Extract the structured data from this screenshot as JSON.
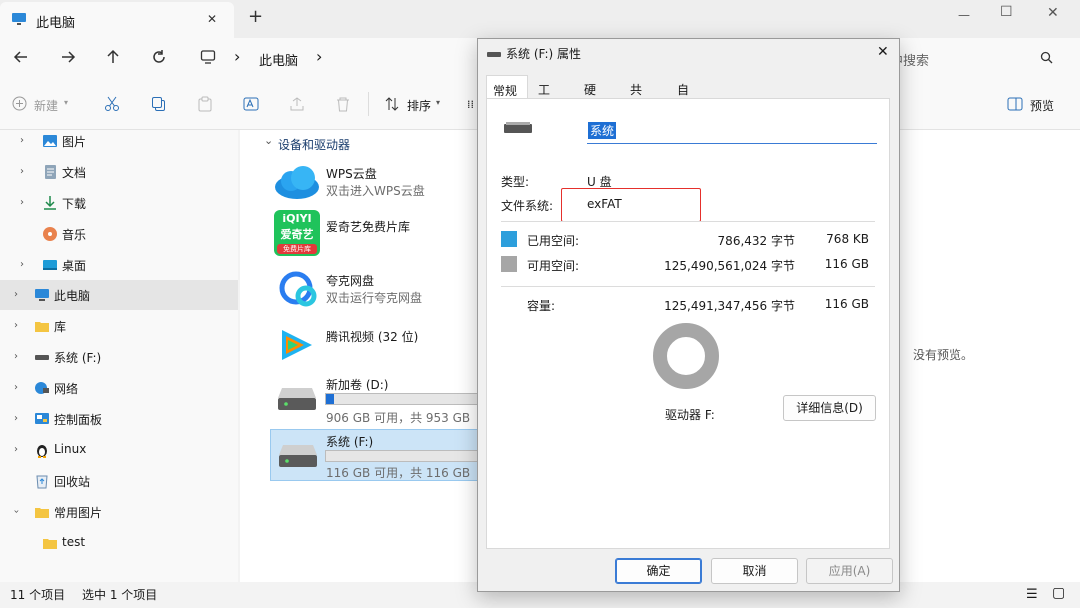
{
  "window": {
    "tab_title": "此电脑",
    "new_tab": "+",
    "minimize": "—",
    "maximize": "☐",
    "close": "✕"
  },
  "nav": {
    "breadcrumb_sep": "›",
    "breadcrumb_item": "此电脑",
    "breadcrumb_sep2": "›",
    "search_placeholder": "中搜索"
  },
  "toolbar": {
    "new_label": "新建",
    "sort_label": "排序",
    "preview_label": "预览"
  },
  "sidebar": {
    "items": [
      {
        "label": "图片"
      },
      {
        "label": "文档"
      },
      {
        "label": "下载"
      },
      {
        "label": "音乐"
      },
      {
        "label": "桌面"
      },
      {
        "label": "此电脑"
      },
      {
        "label": "库"
      },
      {
        "label": "系统 (F:)"
      },
      {
        "label": "网络"
      },
      {
        "label": "控制面板"
      },
      {
        "label": "Linux"
      },
      {
        "label": "回收站"
      },
      {
        "label": "常用图片"
      },
      {
        "label": "test"
      }
    ]
  },
  "main": {
    "section_title": "设备和驱动器",
    "apps": [
      {
        "name": "WPS云盘",
        "sub": "双击进入WPS云盘"
      },
      {
        "name": "爱奇艺免费片库",
        "sub": ""
      },
      {
        "name": "夸克网盘",
        "sub": "双击运行夸克网盘"
      },
      {
        "name": "腾讯视频 (32 位)",
        "sub": ""
      }
    ],
    "drives": [
      {
        "name": "新加卷 (D:)",
        "sub": "906 GB 可用，共 953 GB",
        "used_fraction": 0.05
      },
      {
        "name": "系统 (F:)",
        "sub": "116 GB 可用，共 116 GB",
        "used_fraction": 0.0
      }
    ],
    "iqiyi_logo_top": "iQIYI",
    "iqiyi_logo_mid": "爱奇艺",
    "iqiyi_logo_bot": "免费片库"
  },
  "preview": {
    "empty_text": "没有预览。"
  },
  "status": {
    "count": "11 个项目",
    "selected": "选中 1 个项目"
  },
  "dialog": {
    "title": "系统 (F:) 属性",
    "close": "✕",
    "tabs": [
      "常规",
      "工具",
      "硬件",
      "共享",
      "自定义"
    ],
    "volume_name": "系统",
    "type_label": "类型:",
    "type_value": "U 盘",
    "fs_label": "文件系统:",
    "fs_value": "exFAT",
    "used_label": "已用空间:",
    "used_bytes": "786,432 字节",
    "used_size": "768 KB",
    "free_label": "可用空间:",
    "free_bytes": "125,490,561,024 字节",
    "free_size": "116 GB",
    "cap_label": "容量:",
    "cap_bytes": "125,491,347,456 字节",
    "cap_size": "116 GB",
    "drive_label": "驱动器 F:",
    "details_button": "详细信息(D)",
    "ok_button": "确定",
    "cancel_button": "取消",
    "apply_button": "应用(A)",
    "colors": {
      "used": "#2d9fdc",
      "free": "#a6a6a6",
      "highlight": "#e5302c"
    }
  }
}
